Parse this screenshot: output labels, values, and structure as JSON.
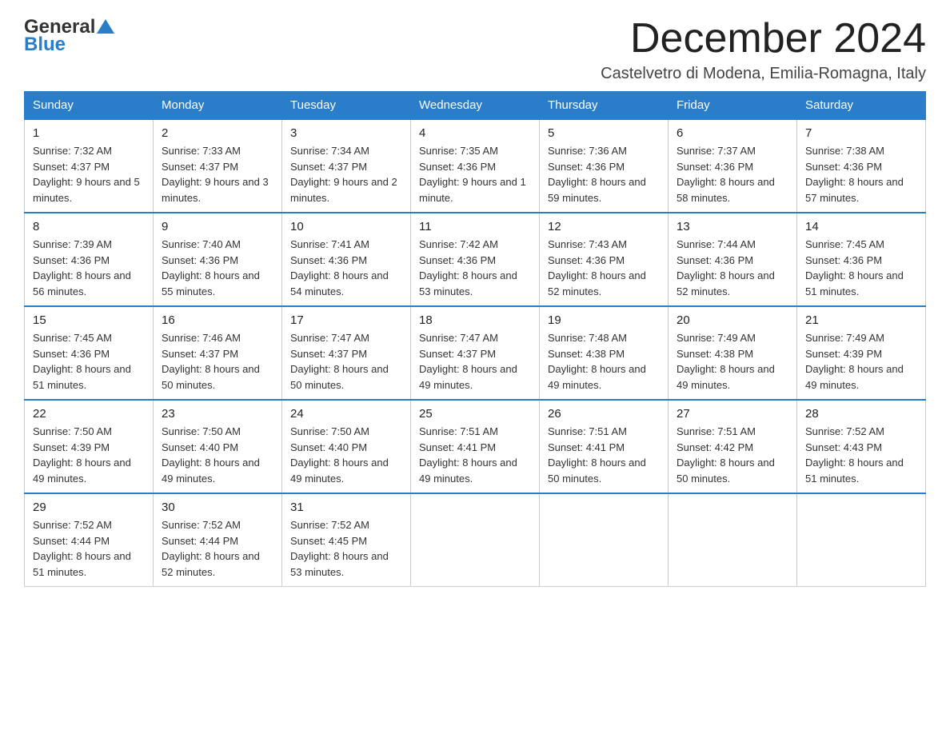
{
  "logo": {
    "part1": "General",
    "part2": "Blue"
  },
  "title": "December 2024",
  "location": "Castelvetro di Modena, Emilia-Romagna, Italy",
  "weekdays": [
    "Sunday",
    "Monday",
    "Tuesday",
    "Wednesday",
    "Thursday",
    "Friday",
    "Saturday"
  ],
  "weeks": [
    [
      {
        "day": "1",
        "sunrise": "7:32 AM",
        "sunset": "4:37 PM",
        "daylight": "9 hours and 5 minutes."
      },
      {
        "day": "2",
        "sunrise": "7:33 AM",
        "sunset": "4:37 PM",
        "daylight": "9 hours and 3 minutes."
      },
      {
        "day": "3",
        "sunrise": "7:34 AM",
        "sunset": "4:37 PM",
        "daylight": "9 hours and 2 minutes."
      },
      {
        "day": "4",
        "sunrise": "7:35 AM",
        "sunset": "4:36 PM",
        "daylight": "9 hours and 1 minute."
      },
      {
        "day": "5",
        "sunrise": "7:36 AM",
        "sunset": "4:36 PM",
        "daylight": "8 hours and 59 minutes."
      },
      {
        "day": "6",
        "sunrise": "7:37 AM",
        "sunset": "4:36 PM",
        "daylight": "8 hours and 58 minutes."
      },
      {
        "day": "7",
        "sunrise": "7:38 AM",
        "sunset": "4:36 PM",
        "daylight": "8 hours and 57 minutes."
      }
    ],
    [
      {
        "day": "8",
        "sunrise": "7:39 AM",
        "sunset": "4:36 PM",
        "daylight": "8 hours and 56 minutes."
      },
      {
        "day": "9",
        "sunrise": "7:40 AM",
        "sunset": "4:36 PM",
        "daylight": "8 hours and 55 minutes."
      },
      {
        "day": "10",
        "sunrise": "7:41 AM",
        "sunset": "4:36 PM",
        "daylight": "8 hours and 54 minutes."
      },
      {
        "day": "11",
        "sunrise": "7:42 AM",
        "sunset": "4:36 PM",
        "daylight": "8 hours and 53 minutes."
      },
      {
        "day": "12",
        "sunrise": "7:43 AM",
        "sunset": "4:36 PM",
        "daylight": "8 hours and 52 minutes."
      },
      {
        "day": "13",
        "sunrise": "7:44 AM",
        "sunset": "4:36 PM",
        "daylight": "8 hours and 52 minutes."
      },
      {
        "day": "14",
        "sunrise": "7:45 AM",
        "sunset": "4:36 PM",
        "daylight": "8 hours and 51 minutes."
      }
    ],
    [
      {
        "day": "15",
        "sunrise": "7:45 AM",
        "sunset": "4:36 PM",
        "daylight": "8 hours and 51 minutes."
      },
      {
        "day": "16",
        "sunrise": "7:46 AM",
        "sunset": "4:37 PM",
        "daylight": "8 hours and 50 minutes."
      },
      {
        "day": "17",
        "sunrise": "7:47 AM",
        "sunset": "4:37 PM",
        "daylight": "8 hours and 50 minutes."
      },
      {
        "day": "18",
        "sunrise": "7:47 AM",
        "sunset": "4:37 PM",
        "daylight": "8 hours and 49 minutes."
      },
      {
        "day": "19",
        "sunrise": "7:48 AM",
        "sunset": "4:38 PM",
        "daylight": "8 hours and 49 minutes."
      },
      {
        "day": "20",
        "sunrise": "7:49 AM",
        "sunset": "4:38 PM",
        "daylight": "8 hours and 49 minutes."
      },
      {
        "day": "21",
        "sunrise": "7:49 AM",
        "sunset": "4:39 PM",
        "daylight": "8 hours and 49 minutes."
      }
    ],
    [
      {
        "day": "22",
        "sunrise": "7:50 AM",
        "sunset": "4:39 PM",
        "daylight": "8 hours and 49 minutes."
      },
      {
        "day": "23",
        "sunrise": "7:50 AM",
        "sunset": "4:40 PM",
        "daylight": "8 hours and 49 minutes."
      },
      {
        "day": "24",
        "sunrise": "7:50 AM",
        "sunset": "4:40 PM",
        "daylight": "8 hours and 49 minutes."
      },
      {
        "day": "25",
        "sunrise": "7:51 AM",
        "sunset": "4:41 PM",
        "daylight": "8 hours and 49 minutes."
      },
      {
        "day": "26",
        "sunrise": "7:51 AM",
        "sunset": "4:41 PM",
        "daylight": "8 hours and 50 minutes."
      },
      {
        "day": "27",
        "sunrise": "7:51 AM",
        "sunset": "4:42 PM",
        "daylight": "8 hours and 50 minutes."
      },
      {
        "day": "28",
        "sunrise": "7:52 AM",
        "sunset": "4:43 PM",
        "daylight": "8 hours and 51 minutes."
      }
    ],
    [
      {
        "day": "29",
        "sunrise": "7:52 AM",
        "sunset": "4:44 PM",
        "daylight": "8 hours and 51 minutes."
      },
      {
        "day": "30",
        "sunrise": "7:52 AM",
        "sunset": "4:44 PM",
        "daylight": "8 hours and 52 minutes."
      },
      {
        "day": "31",
        "sunrise": "7:52 AM",
        "sunset": "4:45 PM",
        "daylight": "8 hours and 53 minutes."
      },
      null,
      null,
      null,
      null
    ]
  ]
}
